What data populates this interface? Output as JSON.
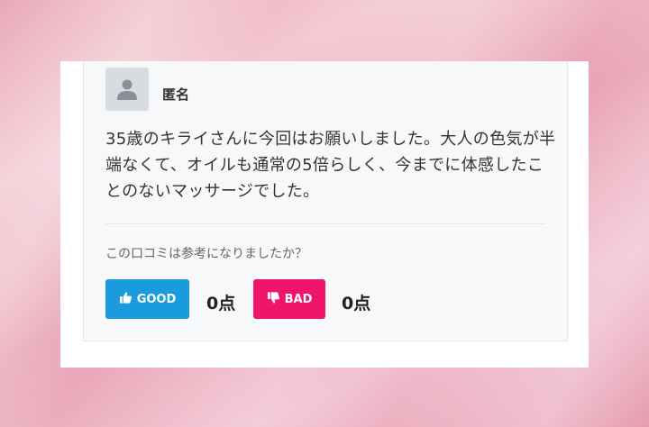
{
  "review": {
    "user_name": "匿名",
    "text": "35歳のキライさんに今回はお願いしました。大人の色気が半端なくて、オイルも通常の5倍らしく、今までに体感したことのないマッサージでした。",
    "helpful_question": "この口コミは参考になりましたか？"
  },
  "votes": {
    "good_label": "GOOD",
    "good_count": "0点",
    "bad_label": "BAD",
    "bad_count": "0点"
  },
  "colors": {
    "good": "#1a9be0",
    "bad": "#f0146b"
  },
  "icons": [
    "user-avatar-icon",
    "thumbs-up-icon",
    "thumbs-down-icon"
  ]
}
